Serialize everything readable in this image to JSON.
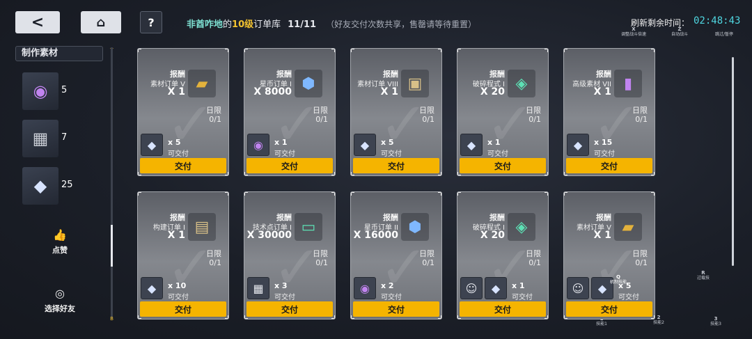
{
  "topbar": {
    "back_icon": "back-arrow-icon",
    "home_icon": "home-icon",
    "help_icon": "question-icon",
    "title_part1": "非酋咋地",
    "title_part2": "的",
    "title_part3": "10级",
    "title_part4": "订单库",
    "count": "11/11",
    "note": "（好友交付次数共享，售罄请等待重置）",
    "refresh_label": "刷新剩余时间：",
    "refresh_time": "02:48:43"
  },
  "hints": {
    "x_key": "X",
    "x_label": "调整战斗倍速",
    "z_key": "Z",
    "z_label": "自动战斗",
    "space_label": "跳过/暂停",
    "r_key": "R",
    "r_label": "过载技",
    "k1_key": "1",
    "k1_label": "技能1",
    "k2_key": "2",
    "k2_label": "技能2",
    "k3_key": "3",
    "k3_label": "技能3"
  },
  "sidebar": {
    "header": "制作素材",
    "scroll_top": "T",
    "scroll_bottom": "B",
    "materials": [
      {
        "icon": "purple-orb-icon",
        "count": "5"
      },
      {
        "icon": "memory-chip-icon",
        "count": "7"
      },
      {
        "icon": "crystal-cube-icon",
        "count": "25"
      }
    ],
    "like_label": "点赞",
    "friend_label": "选择好友"
  },
  "cards": [
    {
      "reward_title": "报酬",
      "reward_name": "素材订单 V",
      "reward_qty": "X 1",
      "reward_icon": "gold-bars-icon",
      "limit_label": "日限",
      "limit_value": "0/1",
      "need_icons": [
        "crystal-cube-icon"
      ],
      "need_qty": "x 5",
      "need_status": "可交付",
      "deliver": "交付"
    },
    {
      "reward_title": "报酬",
      "reward_name": "星币订单 I",
      "reward_qty": "X 8000",
      "reward_icon": "star-coin-icon",
      "limit_label": "日限",
      "limit_value": "0/1",
      "need_icons": [
        "purple-orb-icon"
      ],
      "need_qty": "x 1",
      "need_status": "可交付",
      "deliver": "交付"
    },
    {
      "reward_title": "报酬",
      "reward_name": "素材订单 VIII",
      "reward_qty": "X 1",
      "reward_icon": "weapon-box-icon",
      "limit_label": "日限",
      "limit_value": "0/1",
      "need_icons": [
        "crystal-cube-icon"
      ],
      "need_qty": "x 5",
      "need_status": "可交付",
      "deliver": "交付"
    },
    {
      "reward_title": "报酬",
      "reward_name": "破碎程式 I",
      "reward_qty": "X 20",
      "reward_icon": "green-program-icon",
      "limit_label": "日限",
      "limit_value": "0/1",
      "need_icons": [
        "crystal-cube-icon"
      ],
      "need_qty": "x 1",
      "need_status": "可交付",
      "deliver": "交付"
    },
    {
      "reward_title": "报酬",
      "reward_name": "高级素材 VII",
      "reward_qty": "X 1",
      "reward_icon": "purple-cylinder-icon",
      "limit_label": "日限",
      "limit_value": "0/1",
      "need_icons": [
        "crystal-cube-icon"
      ],
      "need_qty": "x 15",
      "need_status": "可交付",
      "deliver": "交付"
    },
    {
      "reward_title": "报酬",
      "reward_name": "构建订单 I",
      "reward_qty": "X 1",
      "reward_icon": "build-ticket-icon",
      "limit_label": "日限",
      "limit_value": "0/1",
      "need_icons": [
        "crystal-cube-icon"
      ],
      "need_qty": "x 10",
      "need_status": "可交付",
      "deliver": "交付"
    },
    {
      "reward_title": "报酬",
      "reward_name": "技术点订单 I",
      "reward_qty": "X 30000",
      "reward_icon": "exp-ticket-icon",
      "limit_label": "日限",
      "limit_value": "0/1",
      "need_icons": [
        "memory-chip-icon"
      ],
      "need_qty": "x 3",
      "need_status": "可交付",
      "deliver": "交付"
    },
    {
      "reward_title": "报酬",
      "reward_name": "星币订单 II",
      "reward_qty": "X 16000",
      "reward_icon": "star-coin-icon",
      "limit_label": "日限",
      "limit_value": "0/1",
      "need_icons": [
        "purple-orb-icon"
      ],
      "need_qty": "x 2",
      "need_status": "可交付",
      "deliver": "交付"
    },
    {
      "reward_title": "报酬",
      "reward_name": "破碎程式 I",
      "reward_qty": "X 20",
      "reward_icon": "green-program-icon",
      "limit_label": "日限",
      "limit_value": "0/1",
      "need_icons": [
        "character-portrait-icon",
        "crystal-cube-icon"
      ],
      "need_qty": "x 1",
      "need_status": "可交付",
      "deliver": "交付"
    },
    {
      "reward_title": "报酬",
      "reward_name": "素材订单 V",
      "reward_qty": "X 1",
      "reward_icon": "gold-bars-icon",
      "limit_label": "日限",
      "limit_value": "0/1",
      "need_icons": [
        "character-portrait-icon",
        "crystal-cube-icon"
      ],
      "need_qty": "x 5",
      "need_status": "可交付",
      "deliver": "交付",
      "overlay_key": "Q",
      "overlay_label": "机制技能"
    }
  ]
}
